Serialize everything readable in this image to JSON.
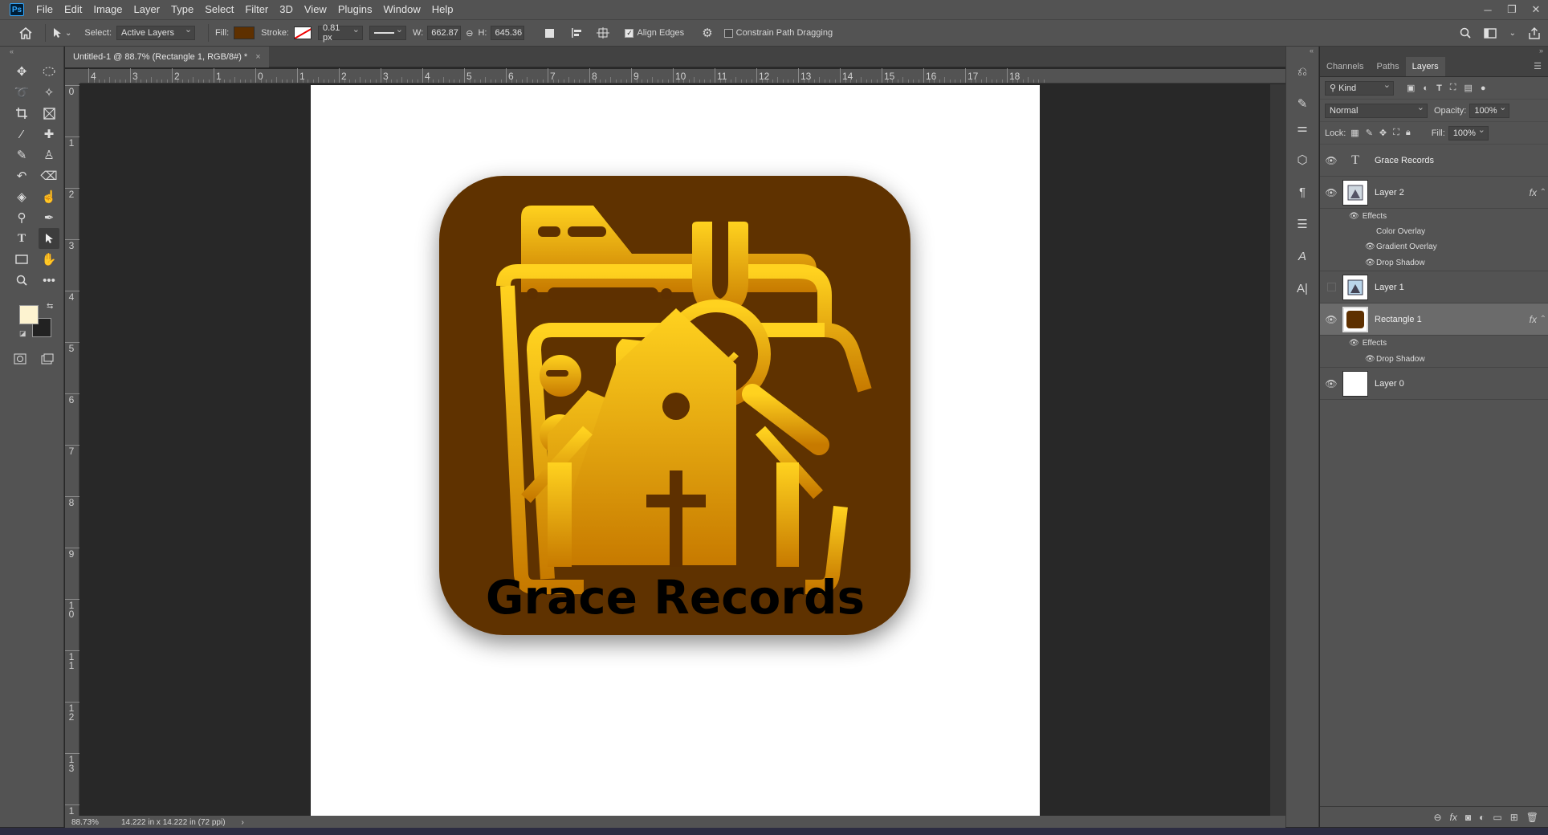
{
  "menubar": {
    "items": [
      "File",
      "Edit",
      "Image",
      "Layer",
      "Type",
      "Select",
      "Filter",
      "3D",
      "View",
      "Plugins",
      "Window",
      "Help"
    ],
    "logo": "Ps"
  },
  "options": {
    "select_label": "Select:",
    "select_value": "Active Layers",
    "fill_label": "Fill:",
    "fill_color": "#5e3000",
    "stroke_label": "Stroke:",
    "stroke_width": "0.81 px",
    "w_label": "W:",
    "w_value": "662.87 p",
    "h_label": "H:",
    "h_value": "645.36 p",
    "align_edges": "Align Edges",
    "constrain": "Constrain Path Dragging"
  },
  "document": {
    "tab_title": "Untitled-1 @ 88.7% (Rectangle 1, RGB/8#) *",
    "close": "×",
    "ruler_top": [
      "4",
      "3",
      "2",
      "1",
      "0",
      "1",
      "2",
      "3",
      "4",
      "5",
      "6",
      "7",
      "8",
      "9",
      "10",
      "11",
      "12",
      "13",
      "14",
      "15",
      "16",
      "17",
      "18"
    ],
    "ruler_left": [
      "0",
      "1",
      "2",
      "3",
      "4",
      "5",
      "6",
      "7",
      "8",
      "9",
      "10",
      "11",
      "12",
      "13",
      "1"
    ],
    "zoom": "88.73%",
    "doc_size": "14.222 in x 14.222 in (72 ppi)",
    "status_arrow": "›"
  },
  "artwork": {
    "title": "Grace Records",
    "icon_bg": "#5e3000",
    "gold_top": "#ffd21f",
    "gold_bottom": "#c77a00"
  },
  "tools": {
    "foreground": "#fdf3d0",
    "background": "#222222"
  },
  "panel": {
    "tabs": [
      "Channels",
      "Paths",
      "Layers"
    ],
    "active_tab": "Layers",
    "filter_kind": "Kind",
    "blend_mode": "Normal",
    "opacity_label": "Opacity:",
    "opacity_value": "100%",
    "lock_label": "Lock:",
    "fill_label": "Fill:",
    "fill_value": "100%",
    "layers": [
      {
        "name": "Grace Records",
        "type": "text",
        "visible": true
      },
      {
        "name": "Layer 2",
        "type": "image",
        "visible": true,
        "fx": "fx",
        "effects_label": "Effects",
        "effects": [
          "Color Overlay",
          "Gradient Overlay",
          "Drop Shadow"
        ]
      },
      {
        "name": "Layer 1",
        "type": "image",
        "visible": false
      },
      {
        "name": "Rectangle 1",
        "type": "shape",
        "visible": true,
        "selected": true,
        "fx": "fx",
        "effects_label": "Effects",
        "effects": [
          "Drop Shadow"
        ]
      },
      {
        "name": "Layer 0",
        "type": "image",
        "visible": true
      }
    ]
  }
}
